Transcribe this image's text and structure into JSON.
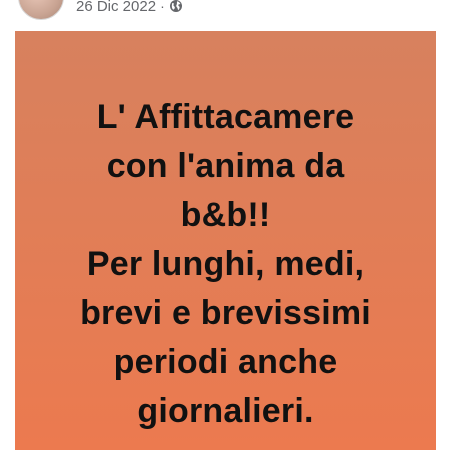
{
  "post": {
    "date": "26 Dic 2022",
    "separator": "·",
    "privacy_icon": "globe-icon",
    "image": {
      "background_top": "#d7815e",
      "background_bottom": "#ec7a4f",
      "text_color": "#111111",
      "lines": [
        "L' Affittacamere",
        "con l'anima da",
        "b&b!!",
        "Per lunghi, medi,",
        "brevi e brevissimi",
        "periodi anche",
        "giornalieri."
      ]
    }
  }
}
